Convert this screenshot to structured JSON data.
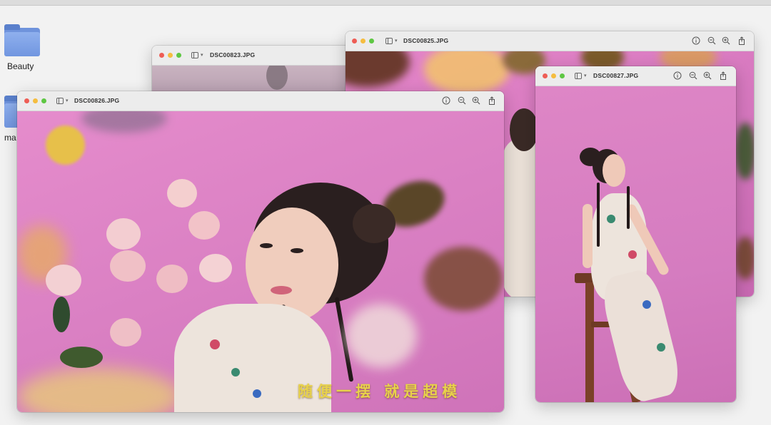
{
  "desktop": {
    "folders": [
      {
        "label": "Beauty",
        "icon": "folder-icon"
      },
      {
        "label": "ma",
        "icon": "folder-icon"
      }
    ]
  },
  "windows": {
    "w823": {
      "title": "DSC00823.JPG"
    },
    "w825": {
      "title": "DSC00825.JPG"
    },
    "w827": {
      "title": "DSC00827.JPG"
    },
    "w826": {
      "title": "DSC00826.JPG"
    }
  },
  "toolbar_icons": [
    "info-icon",
    "zoom-out-icon",
    "zoom-in-icon",
    "share-icon"
  ],
  "caption": "随便一摆  就是超模",
  "colors": {
    "photo_pink": "#d97ec4",
    "caption_yellow": "#e8d24a",
    "traffic_red": "#ee5d55",
    "traffic_yellow": "#f5bd3f",
    "traffic_green": "#5ec743"
  }
}
